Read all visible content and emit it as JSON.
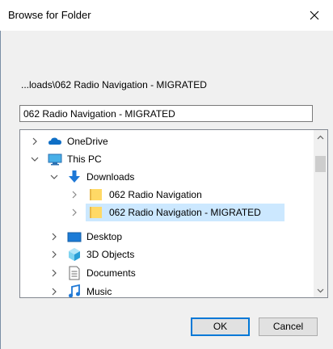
{
  "dialog": {
    "title": "Browse for Folder",
    "path_label": "...loads\\062 Radio Navigation - MIGRATED",
    "folder_field_value": "062 Radio Navigation - MIGRATED"
  },
  "tree": {
    "items": [
      {
        "label": "OneDrive",
        "icon": "cloud-icon",
        "expander": "chevron-right"
      },
      {
        "label": "This PC",
        "icon": "computer-icon",
        "expander": "chevron-down"
      },
      {
        "label": "Downloads",
        "icon": "download-arrow-icon",
        "expander": "chevron-down"
      },
      {
        "label": "062 Radio Navigation",
        "icon": "folder-icon",
        "expander": "chevron-right"
      },
      {
        "label": "062 Radio Navigation - MIGRATED",
        "icon": "folder-icon",
        "expander": "chevron-right",
        "selected": true
      },
      {
        "label": "Desktop",
        "icon": "desktop-icon",
        "expander": "chevron-right"
      },
      {
        "label": "3D Objects",
        "icon": "cube-icon",
        "expander": "chevron-right"
      },
      {
        "label": "Documents",
        "icon": "document-icon",
        "expander": "chevron-right"
      },
      {
        "label": "Music",
        "icon": "music-icon",
        "expander": "chevron-right"
      }
    ]
  },
  "buttons": {
    "ok": "OK",
    "cancel": "Cancel"
  },
  "colors": {
    "selection": "#cce8ff",
    "default_button_border": "#0078d7",
    "folder": "#ffd966"
  }
}
